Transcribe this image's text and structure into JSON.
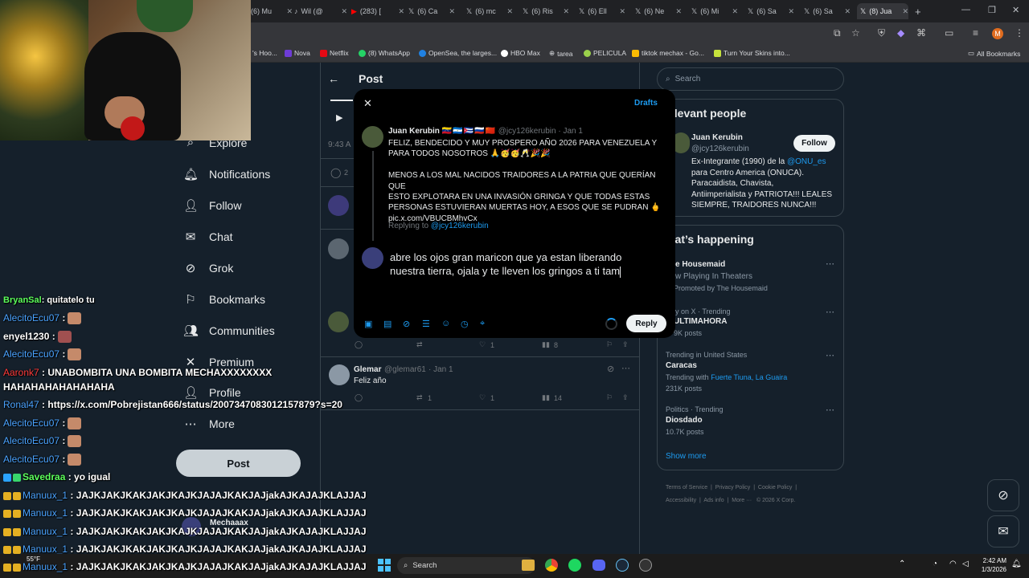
{
  "browser": {
    "tabs": [
      {
        "label": "(6) Mu"
      },
      {
        "label": "Wil (@"
      },
      {
        "label": "(283) ["
      },
      {
        "label": "(6) Ca"
      },
      {
        "label": "(6) mc"
      },
      {
        "label": "(6) Ris"
      },
      {
        "label": "(6) Ell"
      },
      {
        "label": "(6) Ne"
      },
      {
        "label": "(6) Mi"
      },
      {
        "label": "(6) Sa"
      },
      {
        "label": "(6) Sa"
      },
      {
        "label": "(8) Jua"
      }
    ],
    "new_tab": "+",
    "bookmarks": [
      {
        "label": "'s Hoo..."
      },
      {
        "label": "Nova"
      },
      {
        "label": "Netflix"
      },
      {
        "label": "(8) WhatsApp"
      },
      {
        "label": "OpenSea, the larges..."
      },
      {
        "label": "HBO Max"
      },
      {
        "label": "tarea"
      },
      {
        "label": "PELICULA"
      },
      {
        "label": "tiktok mechax - Go..."
      },
      {
        "label": "Turn Your Skins into..."
      }
    ],
    "all_bookmarks": "All Bookmarks"
  },
  "nav": {
    "items": [
      {
        "label": "Explore"
      },
      {
        "label": "Notifications"
      },
      {
        "label": "Follow"
      },
      {
        "label": "Chat"
      },
      {
        "label": "Grok"
      },
      {
        "label": "Bookmarks"
      },
      {
        "label": "Communities"
      },
      {
        "label": "Premium"
      },
      {
        "label": "Profile"
      },
      {
        "label": "More"
      }
    ],
    "post_button": "Post",
    "account_name": "Mechaaax"
  },
  "center": {
    "header_title": "Post",
    "time_partial": "9:43 A",
    "reply_count_partial": "2",
    "tweet_actions_1": {
      "likes": "1",
      "views": "8"
    },
    "glemar_tweet": {
      "name": "Glemar",
      "handle": "@glemar61",
      "date": "· Jan 1",
      "text": "Feliz año",
      "retweets": "1",
      "likes": "1",
      "views": "14"
    }
  },
  "right": {
    "search_placeholder": "Search",
    "relevant_title": "elevant people",
    "person": {
      "name": "Juan Kerubin",
      "handle": "@jcy126kerubin",
      "bio_line1_pre": "Ex-Integrante (1990) de la ",
      "bio_mention": "@ONU_es",
      "bio_line2": "para Centro America (ONUCA).",
      "bio_line3": "Paracaidista, Chavista,",
      "bio_line4": "Antiimperialista y PATRIOTA!!! LEALES",
      "bio_line5": "SIEMPRE, TRAIDORES NUNCA!!!",
      "follow": "Follow"
    },
    "happening_title": "hat’s happening",
    "trends": [
      {
        "title": "e Housemaid",
        "sub": "w Playing In Theaters",
        "sub2": "Promoted by The Housemaid"
      },
      {
        "context": "ly on X · Trending",
        "title": "ULTIMAHORA",
        "posts": "9K posts"
      },
      {
        "context": "Trending in United States",
        "title": "Caracas",
        "with_label": "Trending with ",
        "with_links": "Fuerte Tiuna, La Guaira",
        "posts": "231K posts"
      },
      {
        "context": "Politics · Trending",
        "title": "Diosdado",
        "posts": "10.7K posts"
      }
    ],
    "show_more": "Show more",
    "footer": [
      "Terms of Service",
      "Privacy Policy",
      "Cookie Policy",
      "Accessibility",
      "Ads info",
      "More ···",
      "© 2026 X Corp."
    ]
  },
  "modal": {
    "drafts": "Drafts",
    "tweet": {
      "name": "Juan Kerubin",
      "handle": "@jcy126kerubin",
      "date": "· Jan 1",
      "line1": "FELIZ, BENDECIDO Y MUY PROSPERO AÑO 2026 PARA VENEZUELA Y",
      "line2": "PARA TODOS NOSOTROS",
      "line3": "MENOS A LOS MAL NACIDOS TRAIDORES A LA PATRIA QUE QUERÍAN QUE",
      "line4": "ESTO EXPLOTARA EN UNA INVASIÓN GRINGA Y QUE TODAS ESTAS",
      "line5": "PERSONAS ESTUVIERAN MUERTAS HOY, A ESOS QUE SE PUDRAN",
      "link": "pic.x.com/VBUCBMhvCx"
    },
    "replying_to_label": "Replying to ",
    "replying_to_handle": "@jcy126kerubin",
    "reply_text_line1": "abre los ojos gran maricon que ya estan liberando",
    "reply_text_line2": "nuestra tierra, ojala y te lleven los gringos a ti tam",
    "reply_button": "Reply"
  },
  "chat": [
    {
      "user": "BryanSal",
      "msg": ": quitatelo tu"
    },
    {
      "user": "AlecitoEcu07",
      "msg": " :"
    },
    {
      "user": "enyel1230",
      "msg": " :"
    },
    {
      "user": "AlecitoEcu07",
      "msg": " :"
    },
    {
      "user": "Aaronk7",
      "msg": " : UNABOMBITA UNA BOMBITA MECHAXXXXXXXX"
    },
    {
      "user": "",
      "msg": "HAHAHAHAHAHAHAHA"
    },
    {
      "user": "Ronal47",
      "msg": " : https://x.com/Pobrejistan666/status/2007347083012157879?s=20"
    },
    {
      "user": "AlecitoEcu07",
      "msg": " :"
    },
    {
      "user": "AlecitoEcu07",
      "msg": " :"
    },
    {
      "user": "AlecitoEcu07",
      "msg": " :"
    },
    {
      "user": "Savedraa",
      "msg": " : yo igual"
    },
    {
      "user": "Manuux_1",
      "msg": " : JAJKJAKJKAKJAKJKAJKJAJAJKAKJAJjakAJKAJAJKLAJJAJ"
    },
    {
      "user": "Manuux_1",
      "msg": " : JAJKJAKJKAKJAKJKAJKJAJAJKAKJAJjakAJKAJAJKLAJJAJ"
    },
    {
      "user": "Manuux_1",
      "msg": " : JAJKJAKJKAKJAKJKAJKJAJAJKAKJAJjakAJKAJAJKLAJJAJ"
    },
    {
      "user": "Manuux_1",
      "msg": " : JAJKJAKJKAKJAKJKAJKJAJAJKAKJAJjakAJKAJAJKLAJJAJ"
    },
    {
      "user": "Manuux_1",
      "msg": " : JAJKJAKJKAKJAKJKAJKJAJAJKAKJAJjakAJKAJAJKLAJJAJ"
    }
  ],
  "taskbar": {
    "weather": "55°F",
    "search": "Search",
    "time": "2:42 AM",
    "date": "1/3/2026"
  },
  "colors": {
    "x_bg": "#15202b",
    "modal_bg": "#000000",
    "accent_blue": "#1d9bf0",
    "chat_user_blue": "#4aa3ff"
  }
}
